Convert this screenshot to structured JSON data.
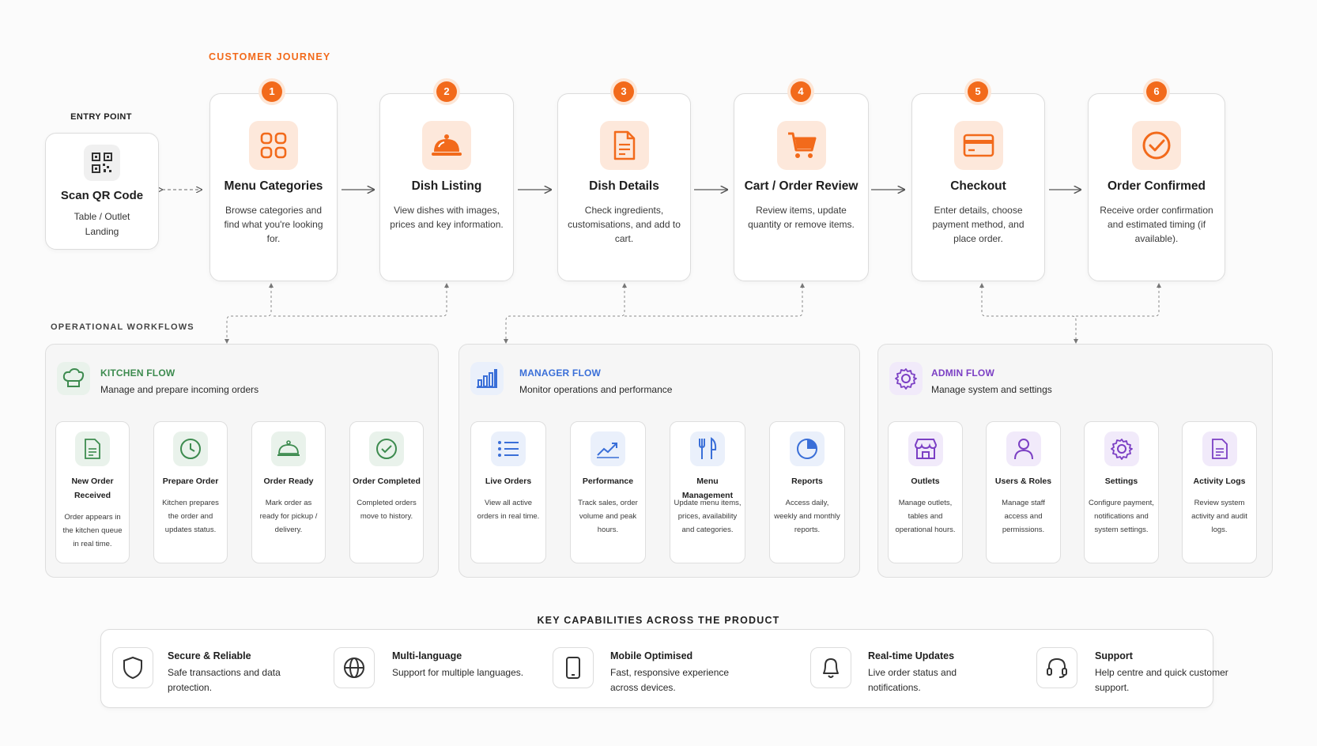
{
  "journey": {
    "label": "CUSTOMER JOURNEY",
    "entry": {
      "label": "ENTRY POINT",
      "title": "Scan QR Code",
      "desc": "Table / Outlet Landing"
    },
    "steps": [
      {
        "num": "1",
        "title": "Menu Categories",
        "desc": "Browse categories and find what you're looking for.",
        "icon": "grid-icon"
      },
      {
        "num": "2",
        "title": "Dish Listing",
        "desc": "View dishes with images, prices and key information.",
        "icon": "cloche-icon"
      },
      {
        "num": "3",
        "title": "Dish Details",
        "desc": "Check ingredients, customisations, and add to cart.",
        "icon": "document-icon"
      },
      {
        "num": "4",
        "title": "Cart / Order Review",
        "desc": "Review items, update quantity or remove items.",
        "icon": "cart-icon"
      },
      {
        "num": "5",
        "title": "Checkout",
        "desc": "Enter details, choose payment method, and place order.",
        "icon": "credit-card-icon"
      },
      {
        "num": "6",
        "title": "Order Confirmed",
        "desc": "Receive order confirmation and estimated timing (if available).",
        "icon": "check-circle-icon"
      }
    ]
  },
  "operational": {
    "label": "OPERATIONAL WORKFLOWS",
    "kitchen": {
      "title": "KITCHEN FLOW",
      "subtitle": "Manage and prepare incoming orders",
      "color": "#3d8b4f",
      "items": [
        {
          "title": "New Order Received",
          "desc": "Order appears in the kitchen queue in real time."
        },
        {
          "title": "Prepare Order",
          "desc": "Kitchen prepares the order and updates status."
        },
        {
          "title": "Order Ready",
          "desc": "Mark order as ready for pickup / delivery."
        },
        {
          "title": "Order Completed",
          "desc": "Completed orders move to history."
        }
      ]
    },
    "manager": {
      "title": "MANAGER FLOW",
      "subtitle": "Monitor operations and performance",
      "color": "#3a6fd8",
      "items": [
        {
          "title": "Live Orders",
          "desc": "View all active orders in real time."
        },
        {
          "title": "Performance",
          "desc": "Track sales, order volume and peak hours."
        },
        {
          "title": "Menu Management",
          "desc": "Update menu items, prices, availability and categories."
        },
        {
          "title": "Reports",
          "desc": "Access daily, weekly and monthly reports."
        }
      ]
    },
    "admin": {
      "title": "ADMIN FLOW",
      "subtitle": "Manage system and settings",
      "color": "#7b3fc4",
      "items": [
        {
          "title": "Outlets",
          "desc": "Manage outlets, tables and operational hours."
        },
        {
          "title": "Users & Roles",
          "desc": "Manage staff access and permissions."
        },
        {
          "title": "Settings",
          "desc": "Configure payment, notifications and system settings."
        },
        {
          "title": "Activity Logs",
          "desc": "Review system activity and audit logs."
        }
      ]
    }
  },
  "capabilities": {
    "label": "KEY CAPABILITIES ACROSS THE PRODUCT",
    "items": [
      {
        "title": "Secure & Reliable",
        "desc": "Safe transactions and data protection.",
        "icon": "shield-icon"
      },
      {
        "title": "Multi-language",
        "desc": "Support for multiple languages.",
        "icon": "globe-icon"
      },
      {
        "title": "Mobile Optimised",
        "desc": "Fast, responsive experience across devices.",
        "icon": "phone-icon"
      },
      {
        "title": "Real-time Updates",
        "desc": "Live order status and notifications.",
        "icon": "bell-icon"
      },
      {
        "title": "Support",
        "desc": "Help centre and quick customer support.",
        "icon": "headset-icon"
      }
    ]
  },
  "colors": {
    "accent": "#f26a1b",
    "accent_soft": "#fde8db"
  }
}
